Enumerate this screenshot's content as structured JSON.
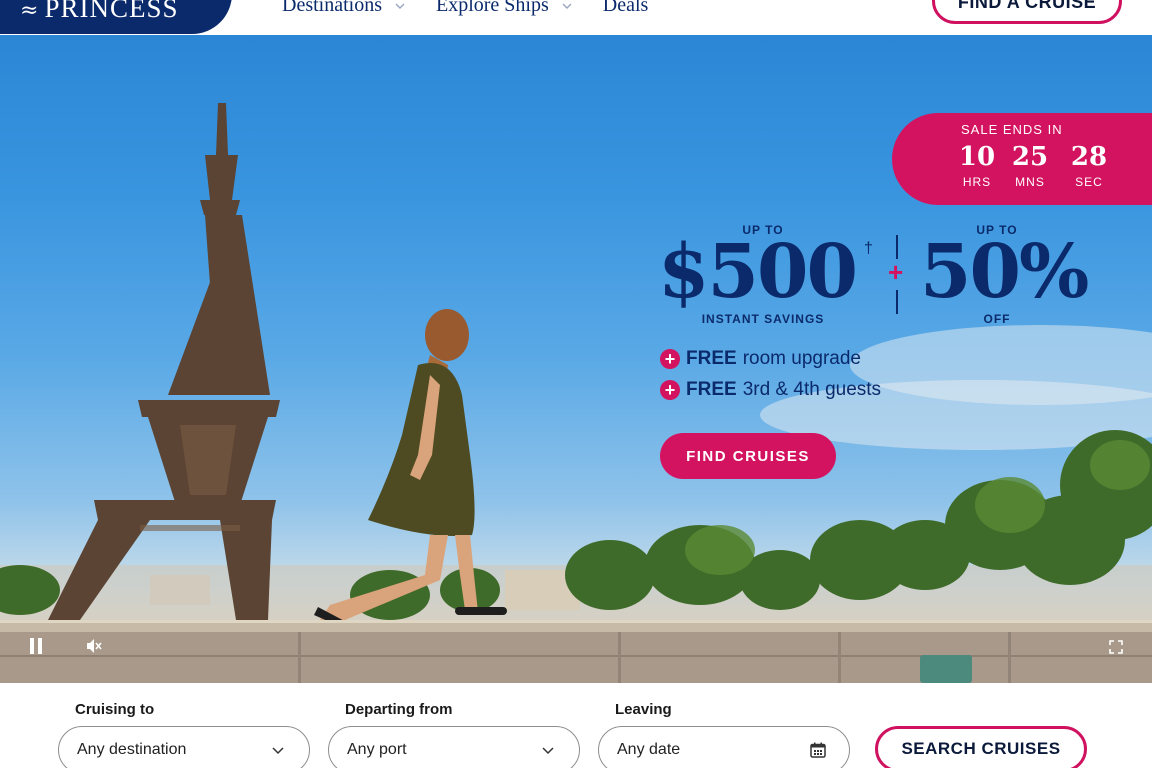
{
  "header": {
    "brand": "PRINCESS",
    "nav": [
      {
        "label": "Destinations",
        "has_dropdown": true
      },
      {
        "label": "Explore Ships",
        "has_dropdown": true
      },
      {
        "label": "Deals",
        "has_dropdown": false
      }
    ],
    "cta_label": "FIND A CRUISE"
  },
  "hero": {
    "sale": {
      "title": "SALE ENDS IN",
      "hours": "10",
      "hours_label": "HRS",
      "minutes": "25",
      "minutes_label": "MNS",
      "seconds": "28",
      "seconds_label": "SEC"
    },
    "offer": {
      "left_small": "UP TO",
      "left_big": "$500",
      "left_mark": "†",
      "left_caption": "INSTANT SAVINGS",
      "plus": "+",
      "right_small": "UP TO",
      "right_big": "50%",
      "right_caption": "OFF"
    },
    "perks": [
      {
        "icon": "plus-icon",
        "strong": "FREE",
        "text": "room upgrade"
      },
      {
        "icon": "plus-icon",
        "strong": "FREE",
        "text": "3rd & 4th guests"
      }
    ],
    "cta_label": "FIND CRUISES",
    "controls": {
      "pause": "pause-icon",
      "mute": "mute-icon",
      "fullscreen": "fullscreen-icon"
    }
  },
  "search": {
    "fields": [
      {
        "label": "Cruising to",
        "value": "Any destination",
        "icon": "chevron-down-icon"
      },
      {
        "label": "Departing from",
        "value": "Any port",
        "icon": "chevron-down-icon"
      },
      {
        "label": "Leaving",
        "value": "Any date",
        "icon": "calendar-icon"
      }
    ],
    "button_label": "SEARCH CRUISES"
  },
  "colors": {
    "brand_navy": "#0b2a6b",
    "accent_pink": "#d3135f"
  }
}
